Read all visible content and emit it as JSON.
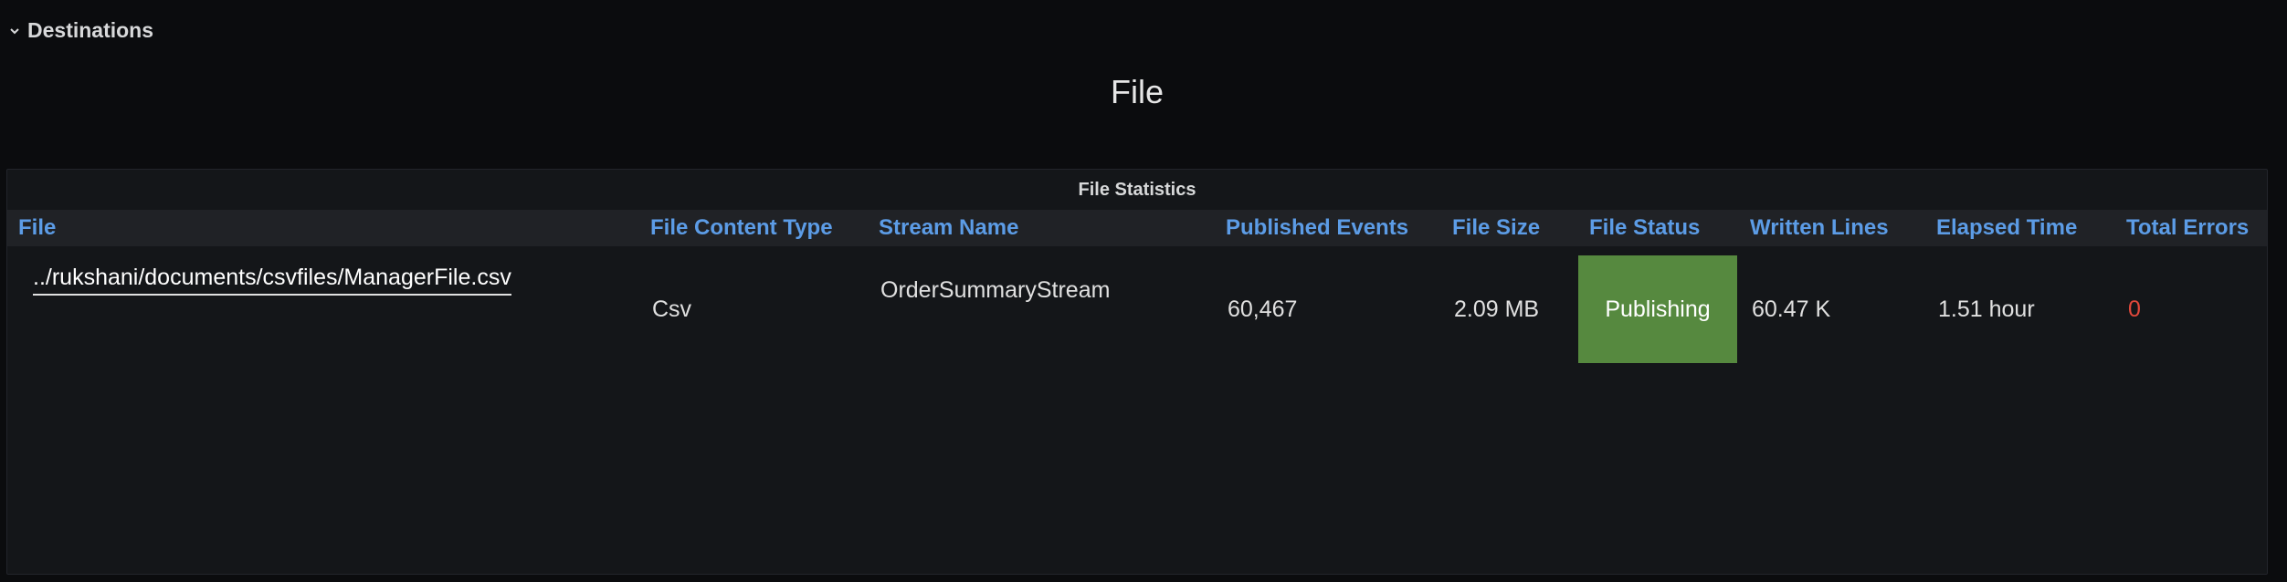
{
  "row": {
    "title": "Destinations"
  },
  "text_panel": {
    "title": "File"
  },
  "stats_panel": {
    "title": "File Statistics",
    "columns": [
      "File",
      "File Content Type",
      "Stream Name",
      "Published Events",
      "File Size",
      "File Status",
      "Written Lines",
      "Elapsed Time",
      "Total Errors"
    ],
    "rows": [
      {
        "file": "../rukshani/documents/csvfiles/ManagerFile.csv",
        "content_type": "Csv",
        "stream_name": "OrderSummaryStream",
        "published_events": "60,467",
        "file_size": "2.09 MB",
        "file_status": "Publishing",
        "written_lines": "60.47 K",
        "elapsed_time": "1.51 hour",
        "total_errors": "0"
      }
    ]
  },
  "colors": {
    "background": "#0b0c0e",
    "panel": "#141619",
    "header_text": "#5c9ce6",
    "status_publishing": "#56893f",
    "errors": "#e0483b"
  },
  "icons": {
    "row_toggle": "chevron-down-icon"
  }
}
